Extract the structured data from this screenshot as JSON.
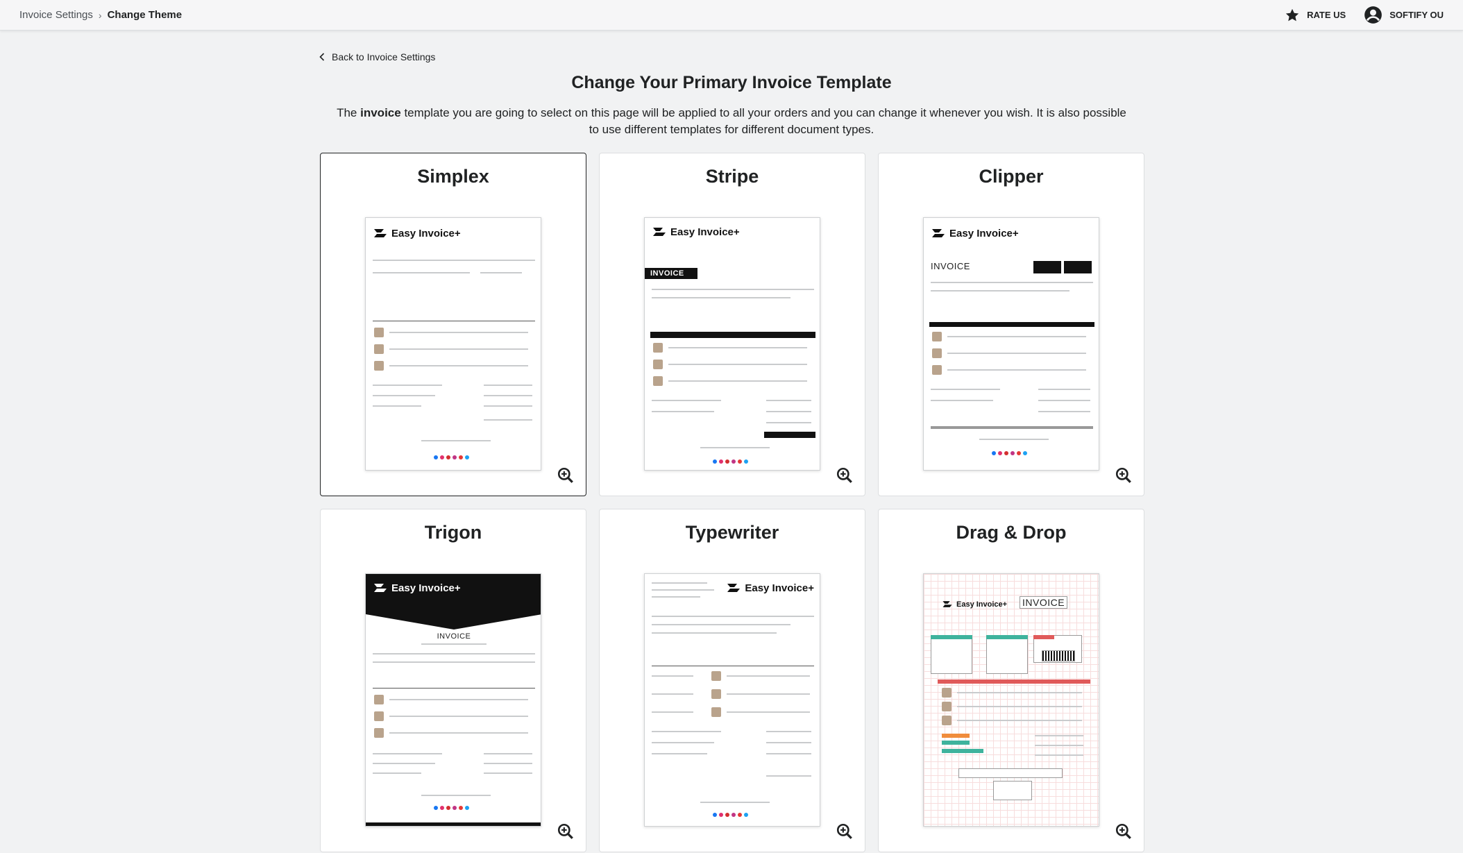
{
  "breadcrumb": {
    "parent": "Invoice Settings",
    "current": "Change Theme"
  },
  "topbar": {
    "rate_label": "RATE US",
    "account_label": "SOFTIFY OU"
  },
  "back_label": "Back to Invoice Settings",
  "title": "Change Your Primary Invoice Template",
  "description": {
    "before": "The ",
    "bold": "invoice",
    "after": " template you are going to select on this page will be applied to all your orders and you can change it whenever you wish. It is also possible to use different templates for different document types."
  },
  "preview_brand": "Easy Invoice+",
  "preview_word": "INVOICE",
  "templates": [
    {
      "name": "Simplex",
      "selected": true
    },
    {
      "name": "Stripe",
      "selected": false
    },
    {
      "name": "Clipper",
      "selected": false
    },
    {
      "name": "Trigon",
      "selected": false
    },
    {
      "name": "Typewriter",
      "selected": false
    },
    {
      "name": "Drag & Drop",
      "selected": false
    }
  ],
  "icons": {
    "star": "star-icon",
    "account": "account-circle-icon",
    "back": "chevron-left-icon",
    "zoom": "zoom-in-icon"
  },
  "colors": {
    "background": "#f1f2f3",
    "card": "#ffffff",
    "text": "#202223"
  }
}
